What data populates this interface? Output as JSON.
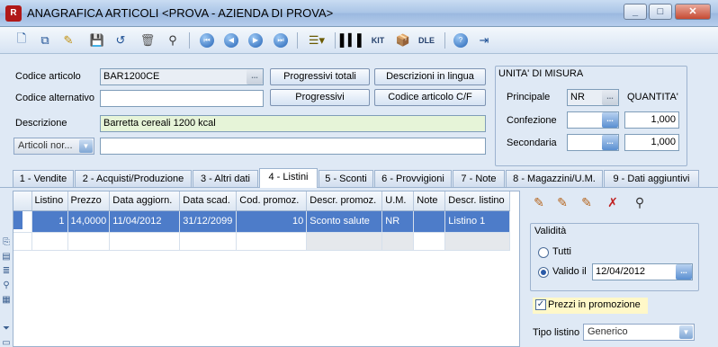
{
  "window": {
    "title": "ANAGRAFICA ARTICOLI <PROVA - AZIENDA DI PROVA>",
    "app_badge": "R",
    "min": "_",
    "max": "□",
    "close": "✕"
  },
  "toolbar": {
    "icons": [
      "new-icon",
      "copy-icon",
      "edit-icon",
      "save-icon",
      "undo-icon",
      "delete-icon",
      "find-icon",
      "first-icon",
      "prev-icon",
      "next-icon",
      "last-icon",
      "list-icon",
      "barcode-icon",
      "kit-icon",
      "box-icon",
      "dle-icon",
      "help-icon",
      "exit-icon"
    ],
    "kit_label": "KIT",
    "dle_label": "DLE"
  },
  "form": {
    "codice_articolo_label": "Codice articolo",
    "codice_articolo_value": "BAR1200CE",
    "codice_alternativo_label": "Codice alternativo",
    "codice_alternativo_value": "",
    "descrizione_label": "Descrizione",
    "descrizione_value": "Barretta cereali 1200 kcal",
    "articoli_combo": "Articoli nor...",
    "articoli_value": "",
    "btn_progressivi_totali": "Progressivi totali",
    "btn_descrizioni_lingua": "Descrizioni in lingua",
    "btn_progressivi": "Progressivi",
    "btn_codice_cf": "Codice articolo C/F",
    "ellipsis": "..."
  },
  "um": {
    "title": "UNITA' DI MISURA",
    "principale_label": "Principale",
    "principale_value": "NR",
    "quantita_label": "QUANTITA'",
    "confezione_label": "Confezione",
    "confezione_value": "",
    "confezione_qty": "1,000",
    "secondaria_label": "Secondaria",
    "secondaria_value": "",
    "secondaria_qty": "1,000"
  },
  "tabs": [
    "1 - Vendite",
    "2 - Acquisti/Produzione",
    "3 - Altri dati",
    "4 - Listini",
    "5 - Sconti",
    "6 - Provvigioni",
    "7 - Note",
    "8 - Magazzini/U.M.",
    "9 - Dati aggiuntivi"
  ],
  "grid": {
    "columns": [
      "Listino",
      "Prezzo",
      "Data aggiorn.",
      "Data scad.",
      "Cod. promoz.",
      "Descr. promoz.",
      "U.M.",
      "Note",
      "Descr. listino"
    ],
    "rows": [
      [
        "1",
        "14,0000",
        "11/04/2012",
        "31/12/2099",
        "10",
        "Sconto salute",
        "NR",
        "",
        "Listino 1"
      ]
    ]
  },
  "right_panel": {
    "validita_title": "Validità",
    "tutti_label": "Tutti",
    "valido_il_label": "Valido il",
    "valido_il_value": "12/04/2012",
    "prezzi_promo_label": "Prezzi in promozione",
    "tipo_listino_label": "Tipo listino",
    "tipo_listino_value": "Generico",
    "selected_radio": "valido_il",
    "prezzi_promo_checked": true
  }
}
